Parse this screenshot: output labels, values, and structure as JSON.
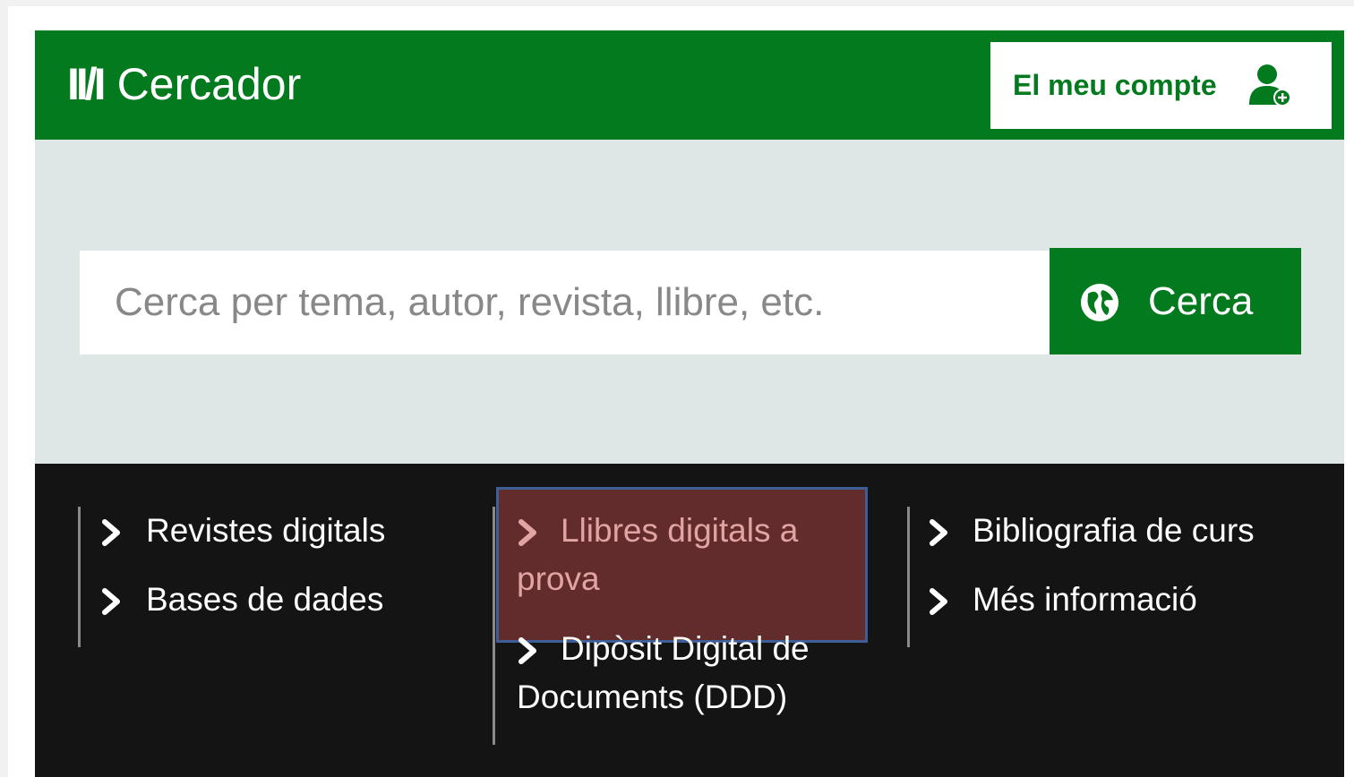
{
  "header": {
    "logo_mark": "II/I",
    "logo_text": "Cercador",
    "account_label": "El meu compte"
  },
  "search": {
    "placeholder": "Cerca per tema, autor, revista, llibre, etc.",
    "button_label": "Cerca"
  },
  "nav": {
    "col1": [
      {
        "label": "Revistes digitals"
      },
      {
        "label": "Bases de dades"
      }
    ],
    "col2": [
      {
        "label_line1": "Llibres digitals a",
        "label_line2": "prova",
        "highlighted": true
      },
      {
        "label_line1": "Dipòsit Digital de",
        "label_line2": "Documents (DDD)"
      }
    ],
    "col3": [
      {
        "label": "Bibliografia de curs"
      },
      {
        "label": "Més informació"
      }
    ]
  },
  "colors": {
    "brand_green": "#027a1d",
    "search_band": "#dee6e6",
    "nav_bg": "#141414",
    "highlight_fill": "#632c2c",
    "highlight_border": "#3e5e97",
    "highlight_text": "#e2a3a3"
  },
  "icons": {
    "account": "user-plus-icon",
    "search": "globe-icon",
    "nav_link": "chevron-right-icon"
  }
}
